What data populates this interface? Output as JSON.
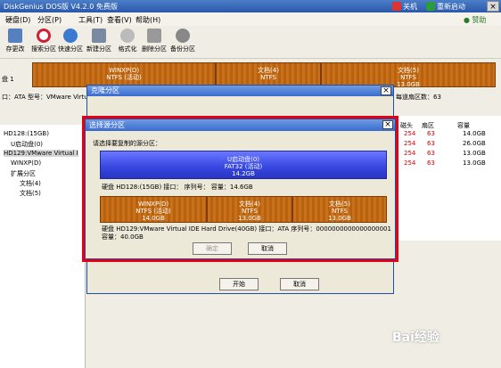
{
  "title": {
    "app": "DiskGenius DOS版 V4.2.0 免费版",
    "shutdown": "关机",
    "restart": "重新启动"
  },
  "menu": [
    "硬盘(D)",
    "分区(P)",
    "工具(T)",
    "查看(V)",
    "帮助(H)"
  ],
  "menu_help_right": "● 赞助",
  "toolbar": [
    "存更改",
    "搜索分区",
    "快速分区",
    "新建分区",
    "格式化",
    "删除分区",
    "备份分区"
  ],
  "main_bar": [
    {
      "l1": "WINXP(D)",
      "l2": "NTFS (活动)"
    },
    {
      "l1": "文档(4)",
      "l2": "NTFS"
    },
    {
      "l1": "文档(5)",
      "l2": "NTFS",
      "l3": "13.0GB"
    }
  ],
  "disk_label": "盘 1",
  "info_line": "口：ATA  型号：VMware Virtual I",
  "info_right": "每道扇区数：63",
  "tree": [
    {
      "label": "HD128:(15GB)"
    },
    {
      "label": "U启动盘(0)"
    },
    {
      "label": "HD129:VMware Virtual I"
    },
    {
      "label": "WINXP(D)"
    },
    {
      "label": "扩展分区"
    },
    {
      "label": "文档(4)"
    },
    {
      "label": "文档(5)"
    }
  ],
  "rp_header": [
    "磁头",
    "扇区",
    "容量"
  ],
  "rp_rows": [
    [
      "254",
      "63",
      "14.0GB"
    ],
    [
      "254",
      "63",
      "26.0GB"
    ],
    [
      "254",
      "63",
      "13.0GB"
    ],
    [
      "254",
      "63",
      "13.0GB"
    ]
  ],
  "dlg1": {
    "title": "克隆分区",
    "start": "开始",
    "cancel": "取消"
  },
  "dlg2": {
    "title": "选择源分区",
    "prompt": "请选择要复制的源分区：",
    "usb": {
      "l1": "U启动盘(0)",
      "l2": "FAT32 (活动)",
      "l3": "14.2GB"
    },
    "disk1_info": "硬盘 HD128:(15GB)   接口：  序列号：  容量：14.6GB",
    "parts": [
      {
        "l1": "WINXP(D)",
        "l2": "NTFS (活动)",
        "l3": "14.0GB"
      },
      {
        "l1": "文档(4)",
        "l2": "NTFS",
        "l3": "13.0GB"
      },
      {
        "l1": "文档(5)",
        "l2": "NTFS",
        "l3": "13.0GB"
      }
    ],
    "disk2_info": "硬盘 HD129:VMware Virtual IDE Hard Drive(40GB)  接口：ATA  序列号：0000000000000000001",
    "disk2_cap": "容量：40.0GB",
    "ok": "确定",
    "cancel": "取消"
  },
  "watermark": "Bai经验"
}
